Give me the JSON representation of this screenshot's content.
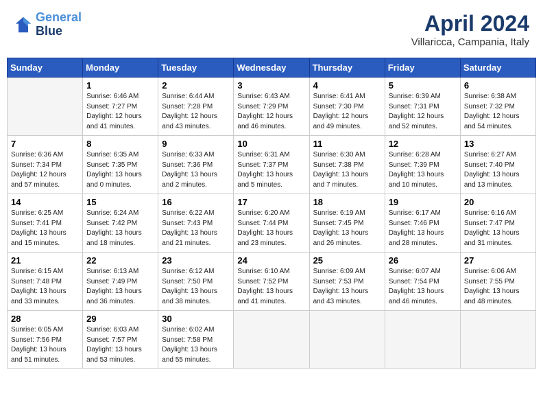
{
  "header": {
    "logo_line1": "General",
    "logo_line2": "Blue",
    "main_title": "April 2024",
    "subtitle": "Villaricca, Campania, Italy"
  },
  "calendar": {
    "days_of_week": [
      "Sunday",
      "Monday",
      "Tuesday",
      "Wednesday",
      "Thursday",
      "Friday",
      "Saturday"
    ],
    "weeks": [
      [
        {
          "day": "",
          "info": ""
        },
        {
          "day": "1",
          "info": "Sunrise: 6:46 AM\nSunset: 7:27 PM\nDaylight: 12 hours\nand 41 minutes."
        },
        {
          "day": "2",
          "info": "Sunrise: 6:44 AM\nSunset: 7:28 PM\nDaylight: 12 hours\nand 43 minutes."
        },
        {
          "day": "3",
          "info": "Sunrise: 6:43 AM\nSunset: 7:29 PM\nDaylight: 12 hours\nand 46 minutes."
        },
        {
          "day": "4",
          "info": "Sunrise: 6:41 AM\nSunset: 7:30 PM\nDaylight: 12 hours\nand 49 minutes."
        },
        {
          "day": "5",
          "info": "Sunrise: 6:39 AM\nSunset: 7:31 PM\nDaylight: 12 hours\nand 52 minutes."
        },
        {
          "day": "6",
          "info": "Sunrise: 6:38 AM\nSunset: 7:32 PM\nDaylight: 12 hours\nand 54 minutes."
        }
      ],
      [
        {
          "day": "7",
          "info": "Sunrise: 6:36 AM\nSunset: 7:34 PM\nDaylight: 12 hours\nand 57 minutes."
        },
        {
          "day": "8",
          "info": "Sunrise: 6:35 AM\nSunset: 7:35 PM\nDaylight: 13 hours\nand 0 minutes."
        },
        {
          "day": "9",
          "info": "Sunrise: 6:33 AM\nSunset: 7:36 PM\nDaylight: 13 hours\nand 2 minutes."
        },
        {
          "day": "10",
          "info": "Sunrise: 6:31 AM\nSunset: 7:37 PM\nDaylight: 13 hours\nand 5 minutes."
        },
        {
          "day": "11",
          "info": "Sunrise: 6:30 AM\nSunset: 7:38 PM\nDaylight: 13 hours\nand 7 minutes."
        },
        {
          "day": "12",
          "info": "Sunrise: 6:28 AM\nSunset: 7:39 PM\nDaylight: 13 hours\nand 10 minutes."
        },
        {
          "day": "13",
          "info": "Sunrise: 6:27 AM\nSunset: 7:40 PM\nDaylight: 13 hours\nand 13 minutes."
        }
      ],
      [
        {
          "day": "14",
          "info": "Sunrise: 6:25 AM\nSunset: 7:41 PM\nDaylight: 13 hours\nand 15 minutes."
        },
        {
          "day": "15",
          "info": "Sunrise: 6:24 AM\nSunset: 7:42 PM\nDaylight: 13 hours\nand 18 minutes."
        },
        {
          "day": "16",
          "info": "Sunrise: 6:22 AM\nSunset: 7:43 PM\nDaylight: 13 hours\nand 21 minutes."
        },
        {
          "day": "17",
          "info": "Sunrise: 6:20 AM\nSunset: 7:44 PM\nDaylight: 13 hours\nand 23 minutes."
        },
        {
          "day": "18",
          "info": "Sunrise: 6:19 AM\nSunset: 7:45 PM\nDaylight: 13 hours\nand 26 minutes."
        },
        {
          "day": "19",
          "info": "Sunrise: 6:17 AM\nSunset: 7:46 PM\nDaylight: 13 hours\nand 28 minutes."
        },
        {
          "day": "20",
          "info": "Sunrise: 6:16 AM\nSunset: 7:47 PM\nDaylight: 13 hours\nand 31 minutes."
        }
      ],
      [
        {
          "day": "21",
          "info": "Sunrise: 6:15 AM\nSunset: 7:48 PM\nDaylight: 13 hours\nand 33 minutes."
        },
        {
          "day": "22",
          "info": "Sunrise: 6:13 AM\nSunset: 7:49 PM\nDaylight: 13 hours\nand 36 minutes."
        },
        {
          "day": "23",
          "info": "Sunrise: 6:12 AM\nSunset: 7:50 PM\nDaylight: 13 hours\nand 38 minutes."
        },
        {
          "day": "24",
          "info": "Sunrise: 6:10 AM\nSunset: 7:52 PM\nDaylight: 13 hours\nand 41 minutes."
        },
        {
          "day": "25",
          "info": "Sunrise: 6:09 AM\nSunset: 7:53 PM\nDaylight: 13 hours\nand 43 minutes."
        },
        {
          "day": "26",
          "info": "Sunrise: 6:07 AM\nSunset: 7:54 PM\nDaylight: 13 hours\nand 46 minutes."
        },
        {
          "day": "27",
          "info": "Sunrise: 6:06 AM\nSunset: 7:55 PM\nDaylight: 13 hours\nand 48 minutes."
        }
      ],
      [
        {
          "day": "28",
          "info": "Sunrise: 6:05 AM\nSunset: 7:56 PM\nDaylight: 13 hours\nand 51 minutes."
        },
        {
          "day": "29",
          "info": "Sunrise: 6:03 AM\nSunset: 7:57 PM\nDaylight: 13 hours\nand 53 minutes."
        },
        {
          "day": "30",
          "info": "Sunrise: 6:02 AM\nSunset: 7:58 PM\nDaylight: 13 hours\nand 55 minutes."
        },
        {
          "day": "",
          "info": ""
        },
        {
          "day": "",
          "info": ""
        },
        {
          "day": "",
          "info": ""
        },
        {
          "day": "",
          "info": ""
        }
      ]
    ]
  }
}
